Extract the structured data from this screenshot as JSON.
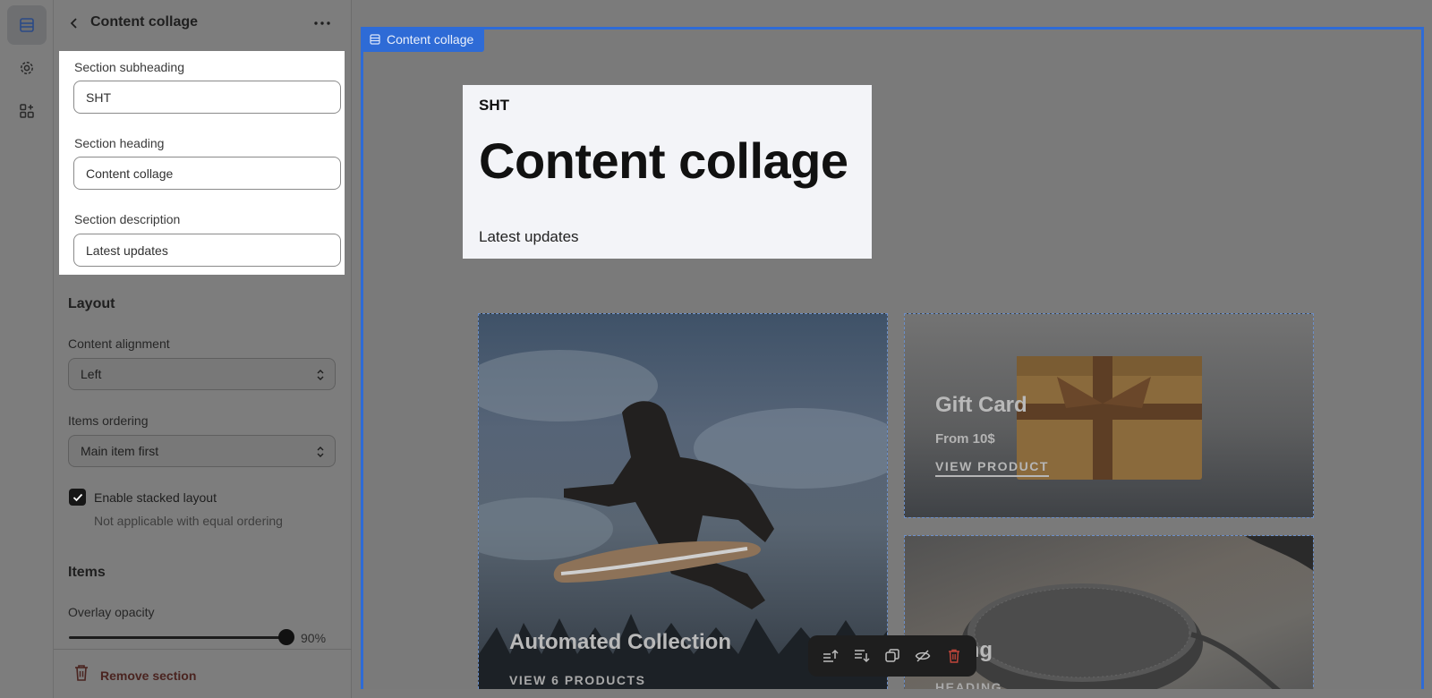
{
  "rail": {
    "items": [
      {
        "icon": "sections-icon",
        "active": true
      },
      {
        "icon": "gear-icon",
        "active": false
      },
      {
        "icon": "apps-add-icon",
        "active": false
      }
    ]
  },
  "panel": {
    "title": "Content collage",
    "fields": {
      "subheading_label": "Section subheading",
      "subheading_value": "SHT",
      "heading_label": "Section heading",
      "heading_value": "Content collage",
      "description_label": "Section description",
      "description_value": "Latest updates"
    },
    "layout": {
      "title": "Layout",
      "alignment_label": "Content alignment",
      "alignment_value": "Left",
      "ordering_label": "Items ordering",
      "ordering_value": "Main item first",
      "stacked_label": "Enable stacked layout",
      "stacked_checked": true,
      "stacked_help": "Not applicable with equal ordering"
    },
    "items": {
      "title": "Items",
      "opacity_label": "Overlay opacity",
      "opacity_value": "90%",
      "opacity_fraction": 0.9
    },
    "remove_label": "Remove section"
  },
  "preview": {
    "tag_label": "Content collage",
    "accent_color": "#2e6bd6",
    "heading_block": {
      "subheading": "SHT",
      "heading": "Content collage",
      "description": "Latest updates"
    },
    "cards": {
      "main": {
        "title": "Automated Collection",
        "link": "VIEW 6 PRODUCTS"
      },
      "gift": {
        "title": "Gift Card",
        "price": "From 10$",
        "link": "VIEW PRODUCT"
      },
      "speaker": {
        "title": "ading",
        "link": "HEADING"
      }
    },
    "toolbar": [
      "move-up-icon",
      "move-down-icon",
      "duplicate-icon",
      "hide-icon",
      "delete-icon"
    ]
  }
}
